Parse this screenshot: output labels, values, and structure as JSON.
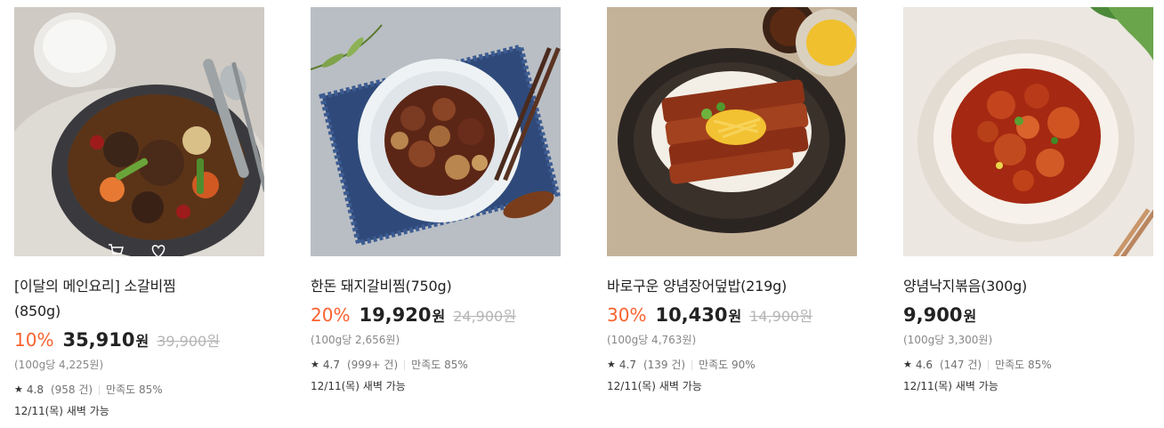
{
  "products": [
    {
      "name_line1": "[이달의 메인요리] 소갈비찜",
      "name_line2": "(850g)",
      "discount": "10%",
      "price": "35,910",
      "won": "원",
      "original_price": "39,900원",
      "unit_price": "(100g당 4,225원)",
      "rating": "4.8",
      "review_count": "(958 건)",
      "satisfaction": "만족도 85%",
      "delivery": "12/11(목) 새벽 가능"
    },
    {
      "name_line1": "한돈 돼지갈비찜(750g)",
      "discount": "20%",
      "price": "19,920",
      "won": "원",
      "original_price": "24,900원",
      "unit_price": "(100g당 2,656원)",
      "rating": "4.7",
      "review_count": "(999+ 건)",
      "satisfaction": "만족도 85%",
      "delivery": "12/11(목) 새벽 가능"
    },
    {
      "name_line1": "바로구운 양념장어덮밥(219g)",
      "discount": "30%",
      "price": "10,430",
      "won": "원",
      "original_price": "14,900원",
      "unit_price": "(100g당 4,763원)",
      "rating": "4.7",
      "review_count": "(139 건)",
      "satisfaction": "만족도 90%",
      "delivery": "12/11(목) 새벽 가능"
    },
    {
      "name_line1": "양념낙지볶음(300g)",
      "price": "9,900",
      "won": "원",
      "unit_price": "(100g당 3,300원)",
      "rating": "4.6",
      "review_count": "(147 건)",
      "satisfaction": "만족도 85%",
      "delivery": "12/11(목) 새벽 가능"
    }
  ],
  "colors": {
    "discount": "#fa622f",
    "price": "#222222",
    "strike": "#b5b5b5",
    "muted": "#888888"
  },
  "icons": {
    "star": "★",
    "cart": "cart-icon",
    "heart": "heart-icon"
  }
}
